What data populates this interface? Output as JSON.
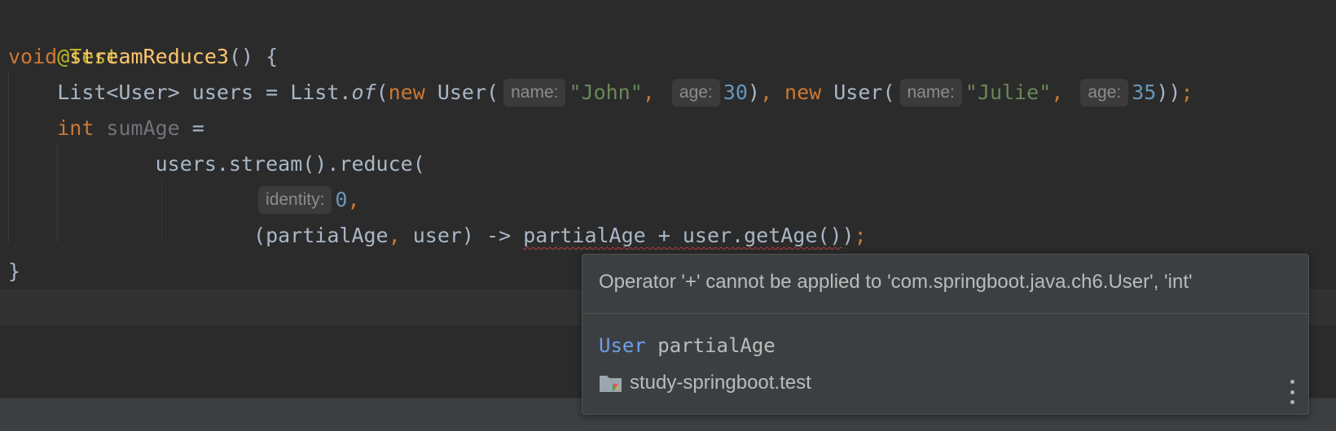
{
  "code": {
    "l1": {
      "annotation": "@Test"
    },
    "l2": {
      "void": "void",
      "method": "streamReduce3",
      "rest": "() {"
    },
    "l3": {
      "indent": "    ",
      "t1": "List<User> users = List.",
      "of": "of",
      "t2": "(",
      "new1": "new",
      "t3": " User(",
      "hint_name1": "name:",
      "str1": "\"John\"",
      "comma1": ", ",
      "hint_age1": "age:",
      "num1": "30",
      "t4": ")",
      "comma2": ", ",
      "new2": "new",
      "t5": " User(",
      "hint_name2": "name:",
      "str2": "\"Julie\"",
      "comma3": ", ",
      "hint_age2": "age:",
      "num2": "35",
      "t6": "))",
      "semi": ";"
    },
    "l4": {
      "indent": "    ",
      "int": "int",
      "var": " sumAge",
      "rest": " ="
    },
    "l5": {
      "indent": "            ",
      "text": "users.stream().reduce("
    },
    "l6": {
      "indent": "                    ",
      "hint_identity": "identity:",
      "num": "0",
      "comma": ","
    },
    "l7": {
      "indent": "                    ",
      "t1": "(partialAge",
      "comma": ", ",
      "t2": "user) -> ",
      "err": "partialAge + user.getAge()",
      "t3": ")",
      "semi": ";"
    },
    "l8": {
      "brace": "}"
    }
  },
  "popup": {
    "message": "Operator '+' cannot be applied to 'com.springboot.java.ch6.User', 'int'",
    "decl_type": "User",
    "decl_name": " partialAge",
    "module": "study-springboot.test",
    "folder_icon": "module-folder-icon",
    "more_icon": "more-vertical-icon"
  },
  "colors": {
    "background": "#2b2b2b",
    "keyword": "#cc7832",
    "method": "#ffc66d",
    "string": "#6a8759",
    "number": "#6897bb",
    "annotation": "#bbb529",
    "error_underline": "#bc3f3c"
  }
}
